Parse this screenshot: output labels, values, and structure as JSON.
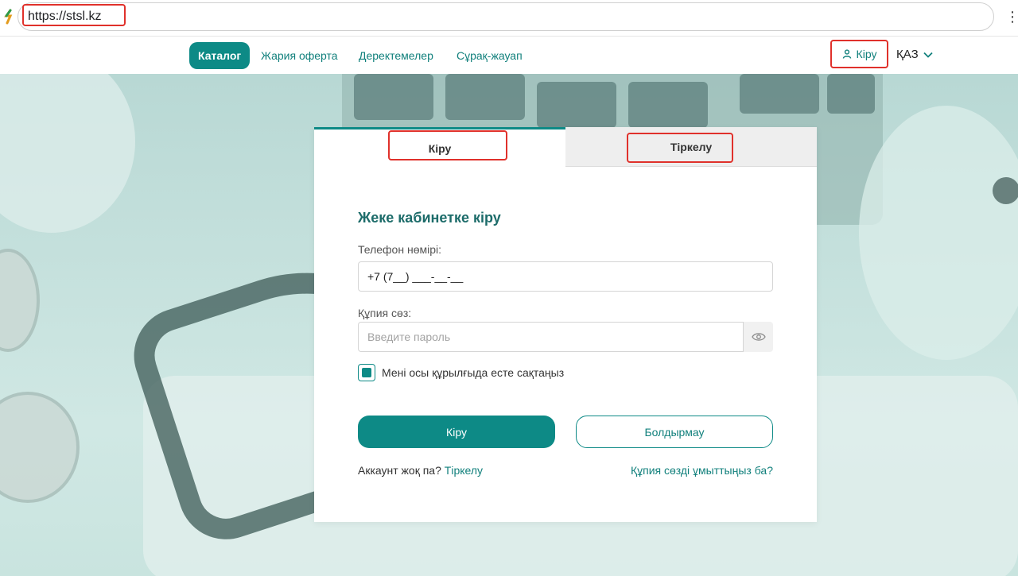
{
  "browser": {
    "url": "https://stsl.kz",
    "menu_glyph": "⋮"
  },
  "header": {
    "nav": {
      "catalog": "Каталог",
      "offer": "Жария оферта",
      "details": "Деректемелер",
      "faq": "Сұрақ-жауап"
    },
    "login_label": "Кіру",
    "language": "ҚАЗ"
  },
  "card": {
    "tabs": {
      "login": "Кіру",
      "register": "Тіркелу"
    },
    "title": "Жеке кабинетке кіру",
    "phone": {
      "label": "Телефон нөмірі:",
      "value": "+7 (7__) ___-__-__"
    },
    "password": {
      "label": "Құпия сөз:",
      "placeholder": "Введите пароль"
    },
    "remember": {
      "label": "Мені осы құрылғыда есте сақтаңыз",
      "checked": true
    },
    "submit_label": "Кіру",
    "cancel_label": "Болдырмау",
    "no_account_text": "Аккаунт жоқ па?",
    "register_link": "Тіркелу",
    "forgot_link": "Құпия сөзді ұмыттыңыз ба?"
  },
  "colors": {
    "accent": "#0d8a86",
    "highlight": "#e0312b"
  }
}
